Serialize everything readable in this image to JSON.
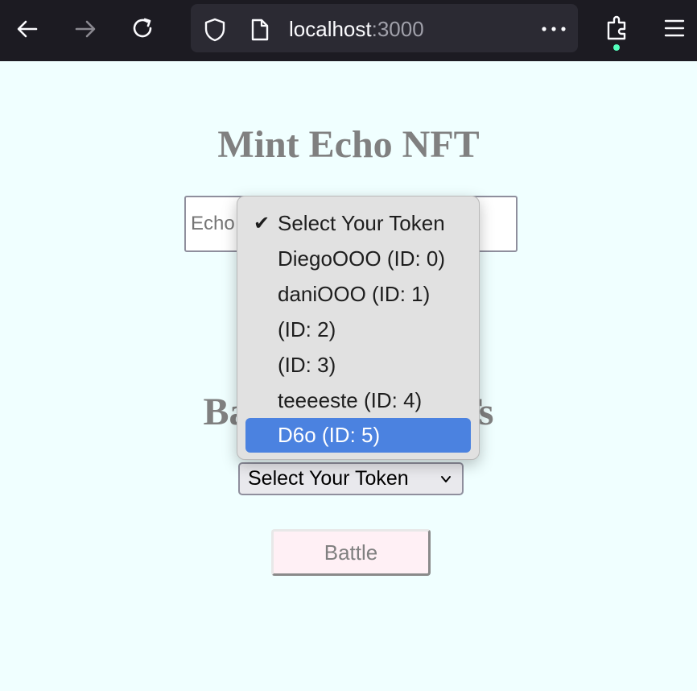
{
  "browser": {
    "url_host": "localhost",
    "url_port": ":3000"
  },
  "mint": {
    "title": "Mint Echo NFT",
    "input_placeholder": "Echo Name"
  },
  "battle": {
    "title": "Battle Echo NFTs",
    "select_value": "Select Your Token",
    "button_label": "Battle"
  },
  "dropdown": {
    "options": [
      {
        "label": "Select Your Token",
        "checked": true
      },
      {
        "label": "DiegoOOO (ID: 0)"
      },
      {
        "label": "daniOOO (ID: 1)"
      },
      {
        "label": "(ID: 2)"
      },
      {
        "label": "(ID: 3)"
      },
      {
        "label": "teeeeste (ID: 4)"
      },
      {
        "label": "D6o (ID: 5)",
        "highlighted": true
      }
    ],
    "check_glyph": "✔"
  },
  "colors": {
    "page_bg": "#f0ffff",
    "heading": "#808080",
    "highlight": "#4b82e0",
    "button_bg": "#fff0f5",
    "toolbar_bg": "#1c1b22"
  }
}
